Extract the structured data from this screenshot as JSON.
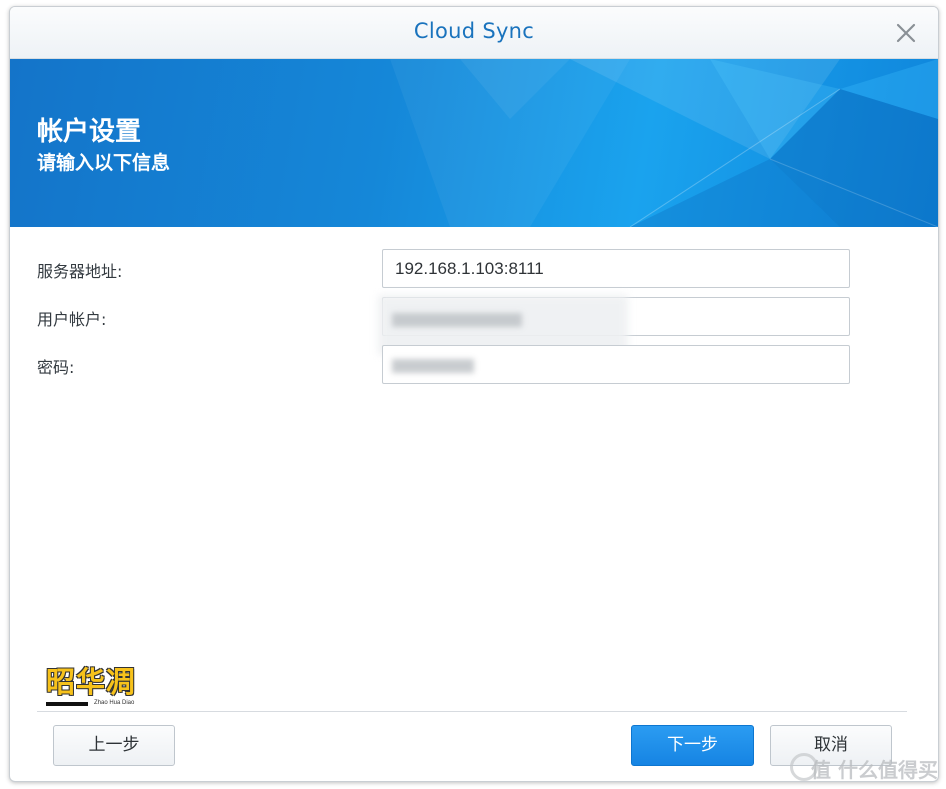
{
  "window": {
    "title": "Cloud Sync",
    "close_icon": "close-icon"
  },
  "banner": {
    "title": "帐户设置",
    "subtitle": "请输入以下信息",
    "colors": {
      "primary": "#1587d8",
      "light": "#1aa3ee"
    }
  },
  "form": {
    "server": {
      "label": "服务器地址:",
      "value": "192.168.1.103:8111"
    },
    "username": {
      "label": "用户帐户:",
      "value": ""
    },
    "password": {
      "label": "密码:",
      "value": ""
    }
  },
  "logo": {
    "text": "昭华凋",
    "caption": "Zhao Hua Diao"
  },
  "footer": {
    "back_label": "上一步",
    "next_label": "下一步",
    "cancel_label": "取消"
  },
  "watermark": {
    "text": "值 什么值得买"
  },
  "accent": "#1684e3"
}
